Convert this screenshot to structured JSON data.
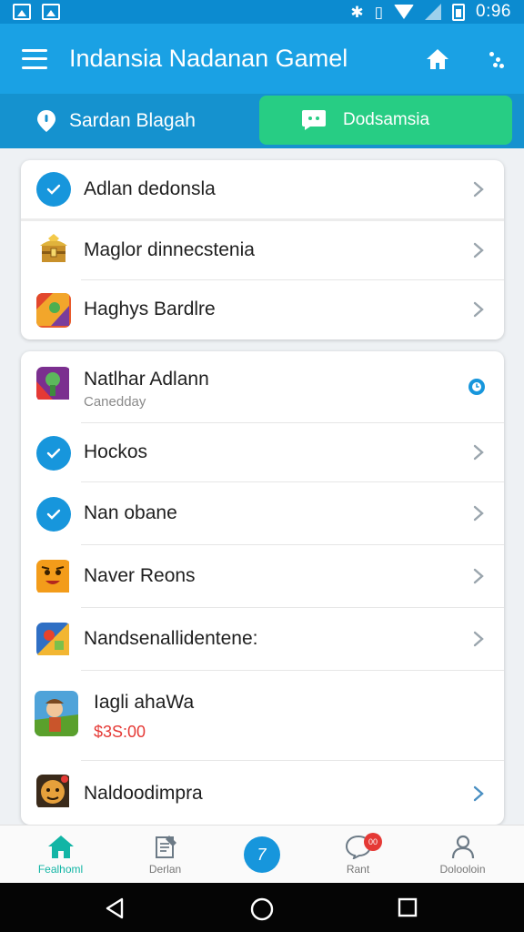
{
  "status_bar": {
    "time": "0:96",
    "left_icons": [
      "gallery-icon",
      "image-icon"
    ],
    "right_icons": [
      "bluetooth-icon",
      "vibrate-icon",
      "wifi-icon",
      "signal-icon",
      "battery-icon"
    ]
  },
  "app_bar": {
    "title": "Indansia Nadanan Gamel",
    "icons": [
      "menu-icon",
      "home-icon",
      "more-icon"
    ]
  },
  "tabs": [
    {
      "label": "Sardan Blagah",
      "icon": "location-pin-icon",
      "active": false
    },
    {
      "label": "Dodsamsia",
      "icon": "chat-icon",
      "active": true
    }
  ],
  "card1": {
    "items": [
      {
        "label": "Adlan dedonsla",
        "icon": "check-circle-icon"
      },
      {
        "label": "Maglor dinnecstenia",
        "icon": "treasure-chest-icon"
      },
      {
        "label": "Haghys Bardlre",
        "icon": "game-app-icon"
      }
    ]
  },
  "card2": {
    "items": [
      {
        "label": "Natlhar Adlann",
        "sub": "Canedday",
        "icon": "game-app-icon",
        "trailing": "clock-indicator-icon"
      },
      {
        "label": "Hockos",
        "icon": "check-circle-icon"
      },
      {
        "label": "Nan obane",
        "icon": "check-circle-icon"
      },
      {
        "label": "Naver Reons",
        "icon": "face-game-icon"
      },
      {
        "label": "Nandsenallidentene:",
        "icon": "game-app-icon"
      },
      {
        "label": "Iagli ahaWa",
        "sub": "$3S:00",
        "icon": "adventure-game-icon"
      },
      {
        "label": "Naldoodimpra",
        "icon": "character-game-icon"
      }
    ]
  },
  "bottom_nav": {
    "items": [
      {
        "label": "Fealhoml",
        "icon": "home-icon",
        "active": true
      },
      {
        "label": "Derlan",
        "icon": "note-icon",
        "active": false
      },
      {
        "label": "",
        "icon": "compose-fab-icon",
        "fab_glyph": "7",
        "active": false
      },
      {
        "label": "Rant",
        "icon": "chat-bubble-icon",
        "badge": "00",
        "active": false
      },
      {
        "label": "Dolooloin",
        "icon": "profile-icon",
        "active": false
      }
    ]
  },
  "colors": {
    "app_bar": "#1aa1e4",
    "status_bar": "#0c8bd0",
    "tab_strip": "#1592cf",
    "active_tab": "#27cd84",
    "accent_blue": "#1796dc",
    "active_nav": "#12b5a5",
    "price_red": "#e53935"
  }
}
